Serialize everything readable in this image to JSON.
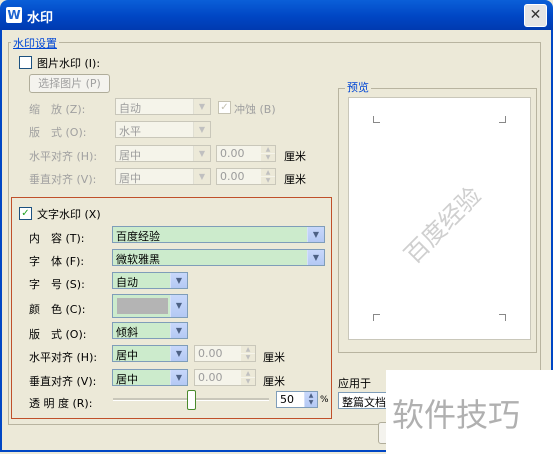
{
  "window": {
    "title": "水印",
    "app_icon_glyph": "W",
    "close_glyph": "✕"
  },
  "settings_group": {
    "label": "水印设置"
  },
  "picture": {
    "checkbox_label": "图片水印",
    "hotkey": "(I):",
    "checked": false,
    "select_button": "选择图片 (P)",
    "scale": {
      "label": "缩　放",
      "hotkey": "(Z):",
      "value": "自动"
    },
    "washout": {
      "label": "冲蚀",
      "hotkey": "(B)"
    },
    "layout": {
      "label": "版　式",
      "hotkey": "(O):",
      "value": "水平"
    },
    "h_align": {
      "label": "水平对齐",
      "hotkey": "(H):",
      "value": "居中",
      "offset": "0.00",
      "unit": "厘米"
    },
    "v_align": {
      "label": "垂直对齐",
      "hotkey": "(V):",
      "value": "居中",
      "offset": "0.00",
      "unit": "厘米"
    }
  },
  "text": {
    "checkbox_label": "文字水印",
    "hotkey": "(X)",
    "checked": true,
    "check_glyph": "✓",
    "content": {
      "label": "内　容",
      "hotkey": "(T):",
      "value": "百度经验"
    },
    "font": {
      "label": "字　体",
      "hotkey": "(F):",
      "value": "微软雅黑"
    },
    "size": {
      "label": "字　号",
      "hotkey": "(S):",
      "value": "自动"
    },
    "color": {
      "label": "颜　色",
      "hotkey": "(C):",
      "swatch": "#b4b4b4"
    },
    "layout": {
      "label": "版　式",
      "hotkey": "(O):",
      "value": "倾斜"
    },
    "h_align": {
      "label": "水平对齐",
      "hotkey": "(H):",
      "value": "居中",
      "offset": "0.00",
      "unit": "厘米"
    },
    "v_align": {
      "label": "垂直对齐",
      "hotkey": "(V):",
      "value": "居中",
      "offset": "0.00",
      "unit": "厘米"
    },
    "transparency": {
      "label": "透 明 度",
      "hotkey": "(R):",
      "value": "50",
      "unit": "%",
      "level_percent": 50
    }
  },
  "preview": {
    "label": "预览",
    "watermark_text": "百度经验"
  },
  "apply": {
    "label": "应用于",
    "value": "整篇文档"
  },
  "overlay_watermark": "软件技巧",
  "colors": {
    "accent": "#0046d5",
    "highlight_border": "#c0502a",
    "combo_fill": "#ccebcc"
  },
  "icons": {
    "dropdown": "▼",
    "spin_up": "▲",
    "spin_down": "▼"
  }
}
